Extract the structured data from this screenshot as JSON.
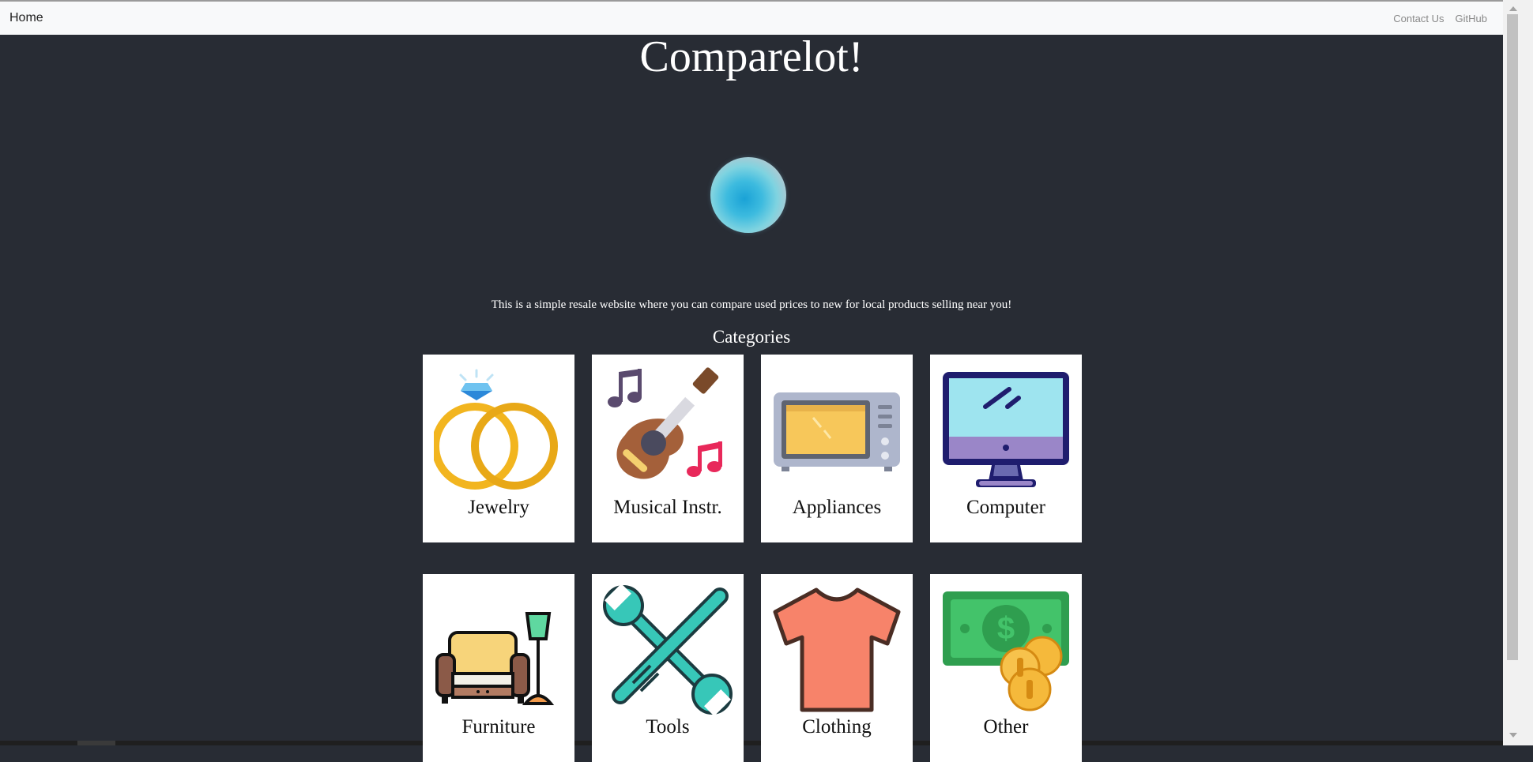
{
  "nav": {
    "home": "Home",
    "links": [
      "Contact Us",
      "GitHub"
    ]
  },
  "hero": {
    "title": "Comparelot!",
    "description": "This is a simple resale website where you can compare used prices to new for local products selling near you!"
  },
  "categories": {
    "heading": "Categories",
    "items": [
      {
        "label": "Jewelry",
        "icon": "rings-icon"
      },
      {
        "label": "Musical Instr.",
        "icon": "guitar-icon"
      },
      {
        "label": "Appliances",
        "icon": "microwave-icon"
      },
      {
        "label": "Computer",
        "icon": "monitor-icon"
      },
      {
        "label": "Furniture",
        "icon": "armchair-lamp-icon"
      },
      {
        "label": "Tools",
        "icon": "wrench-screwdriver-icon"
      },
      {
        "label": "Clothing",
        "icon": "tshirt-icon"
      },
      {
        "label": "Other",
        "icon": "money-coins-icon"
      }
    ]
  }
}
